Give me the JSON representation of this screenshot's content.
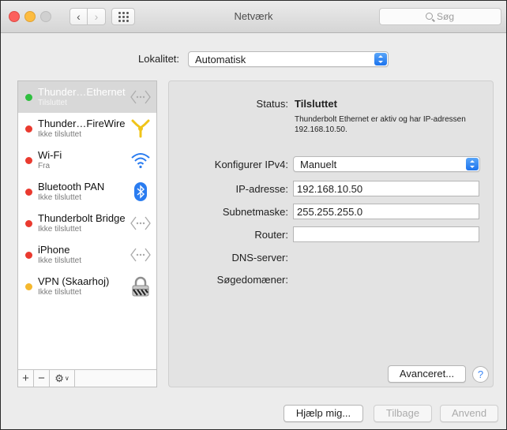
{
  "window": {
    "title": "Netværk"
  },
  "search": {
    "placeholder": "Søg"
  },
  "location": {
    "label": "Lokalitet:",
    "value": "Automatisk"
  },
  "services": [
    {
      "name": "Thunder…Ethernet",
      "status": "Tilsluttet",
      "dot": "#2fbf3f",
      "icon": "ethernet-icon",
      "selected": true
    },
    {
      "name": "Thunder…FireWire",
      "status": "Ikke tilsluttet",
      "dot": "#ea3a2f",
      "icon": "firewire-icon"
    },
    {
      "name": "Wi-Fi",
      "status": "Fra",
      "dot": "#ea3a2f",
      "icon": "wifi-icon"
    },
    {
      "name": "Bluetooth PAN",
      "status": "Ikke tilsluttet",
      "dot": "#ea3a2f",
      "icon": "bluetooth-icon"
    },
    {
      "name": "Thunderbolt Bridge",
      "status": "Ikke tilsluttet",
      "dot": "#ea3a2f",
      "icon": "ethernet-icon"
    },
    {
      "name": "iPhone",
      "status": "Ikke tilsluttet",
      "dot": "#ea3a2f",
      "icon": "ethernet-icon"
    },
    {
      "name": "VPN (Skaarhoj)",
      "status": "Ikke tilsluttet",
      "dot": "#f5b82e",
      "icon": "vpn-lock-icon"
    }
  ],
  "sidebar_buttons": {
    "add": "+",
    "remove": "−",
    "action": "⚙"
  },
  "detail": {
    "status_label": "Status:",
    "status_value": "Tilsluttet",
    "status_desc": "Thunderbolt Ethernet er aktiv og har IP-adressen 192.168.10.50.",
    "ipv4_label": "Konfigurer IPv4:",
    "ipv4_value": "Manuelt",
    "ip_label": "IP-adresse:",
    "ip_value": "192.168.10.50",
    "subnet_label": "Subnetmaske:",
    "subnet_value": "255.255.255.0",
    "router_label": "Router:",
    "router_value": "",
    "dns_label": "DNS-server:",
    "search_domains_label": "Søgedomæner:",
    "advanced_button": "Avanceret...",
    "help_button": "?"
  },
  "footer": {
    "assist": "Hjælp mig...",
    "revert": "Tilbage",
    "apply": "Anvend"
  },
  "colors": {
    "accent": "#1c73ed",
    "selection": "#d8d8d8"
  }
}
